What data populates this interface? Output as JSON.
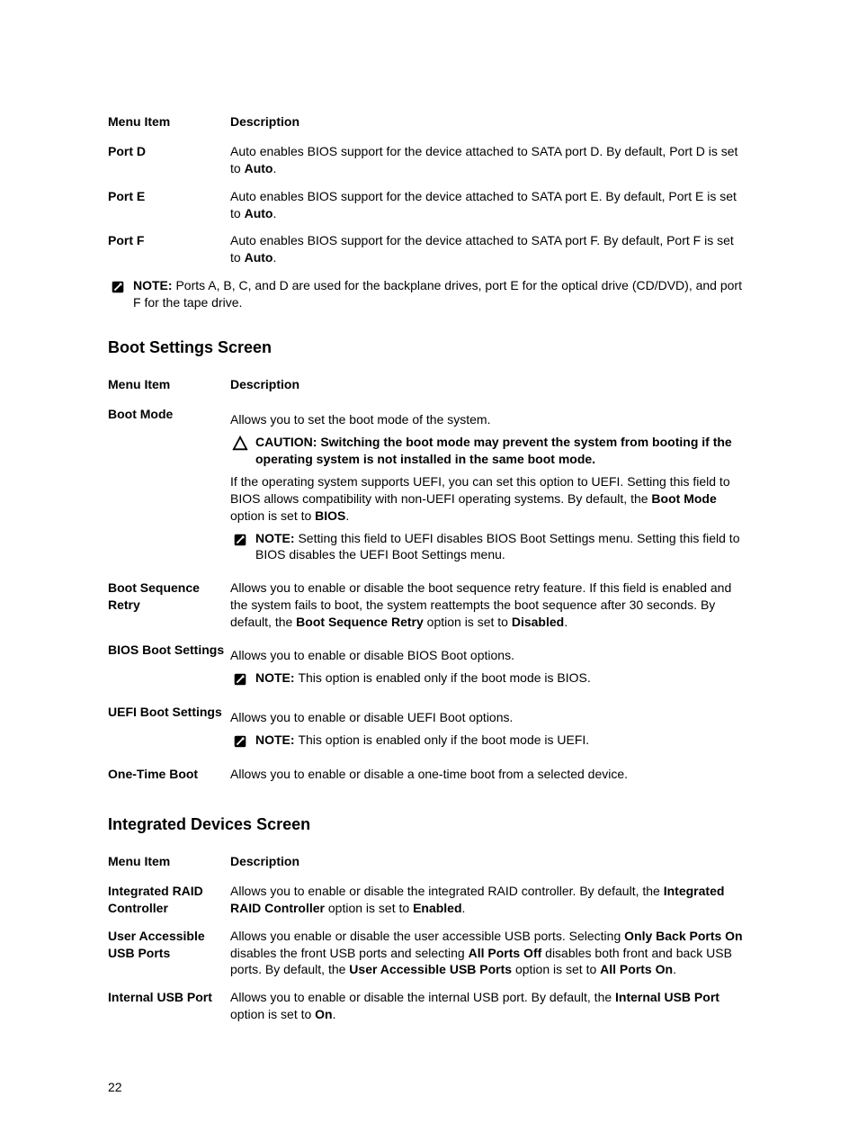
{
  "top_table": {
    "header": {
      "menu": "Menu Item",
      "desc": "Description"
    },
    "rows": [
      {
        "menu": "Port D",
        "d1": "Auto enables BIOS support for the device attached to SATA port D. By default, Port D is set to ",
        "bold": "Auto",
        "d2": "."
      },
      {
        "menu": "Port E",
        "d1": "Auto enables BIOS support for the device attached to SATA port E. By default, Port E is set to ",
        "bold": "Auto",
        "d2": "."
      },
      {
        "menu": "Port F",
        "d1": "Auto enables BIOS support for the device attached to SATA port F. By default, Port F is set to ",
        "bold": "Auto",
        "d2": "."
      }
    ]
  },
  "top_note": {
    "label": "NOTE: ",
    "text": "Ports A, B, C, and D are used for the backplane drives, port E for the optical drive (CD/DVD), and port F for the tape drive."
  },
  "boot_section": {
    "title": "Boot Settings Screen",
    "header": {
      "menu": "Menu Item",
      "desc": "Description"
    },
    "boot_mode": {
      "menu": "Boot Mode",
      "lead": "Allows you to set the boot mode of the system.",
      "caution_label": "CAUTION: ",
      "caution_text": "Switching the boot mode may prevent the system from booting if the operating system is not installed in the same boot mode.",
      "p1a": "If the operating system supports UEFI, you can set this option to UEFI. Setting this field to BIOS allows compatibility with non-UEFI operating systems. By default, the ",
      "p1b": "Boot Mode",
      "p1c": " option is set to ",
      "p1d": "BIOS",
      "p1e": ".",
      "note_label": "NOTE: ",
      "note_text": "Setting this field to UEFI disables BIOS Boot Settings menu. Setting this field to BIOS disables the UEFI Boot Settings menu."
    },
    "boot_seq": {
      "menu": "Boot Sequence Retry",
      "d1": "Allows you to enable or disable the boot sequence retry feature. If this field is enabled and the system fails to boot, the system reattempts the boot sequence after 30 seconds. By default, the ",
      "b1": "Boot Sequence Retry",
      "d2": " option is set to ",
      "b2": "Disabled",
      "d3": "."
    },
    "bios_boot": {
      "menu": "BIOS Boot Settings",
      "lead": "Allows you to enable or disable BIOS Boot options.",
      "note_label": "NOTE: ",
      "note_text": "This option is enabled only if the boot mode is BIOS."
    },
    "uefi_boot": {
      "menu": "UEFI Boot Settings",
      "lead": "Allows you to enable or disable UEFI Boot options.",
      "note_label": "NOTE: ",
      "note_text": "This option is enabled only if the boot mode is UEFI."
    },
    "one_time": {
      "menu": "One-Time Boot",
      "desc": "Allows you to enable or disable a one-time boot from a selected device."
    }
  },
  "int_section": {
    "title": "Integrated Devices Screen",
    "header": {
      "menu": "Menu Item",
      "desc": "Description"
    },
    "raid": {
      "menu": "Integrated RAID Controller",
      "d1": "Allows you to enable or disable the integrated RAID controller. By default, the ",
      "b1": "Integrated RAID Controller",
      "d2": " option is set to ",
      "b2": "Enabled",
      "d3": "."
    },
    "usb": {
      "menu": "User Accessible USB Ports",
      "d1": "Allows you enable or disable the user accessible USB ports. Selecting ",
      "b1": "Only Back Ports On",
      "d2": " disables the front USB ports and selecting ",
      "b2": "All Ports Off",
      "d3": " disables both front and back USB ports. By default, the ",
      "b3": "User Accessible USB Ports",
      "d4": " option is set to ",
      "b4": "All Ports On",
      "d5": "."
    },
    "int_usb": {
      "menu": "Internal USB Port",
      "d1": "Allows you to enable or disable the internal USB port. By default, the ",
      "b1": "Internal USB Port",
      "d2": " option is set to ",
      "b2": "On",
      "d3": "."
    }
  },
  "page_num": "22"
}
